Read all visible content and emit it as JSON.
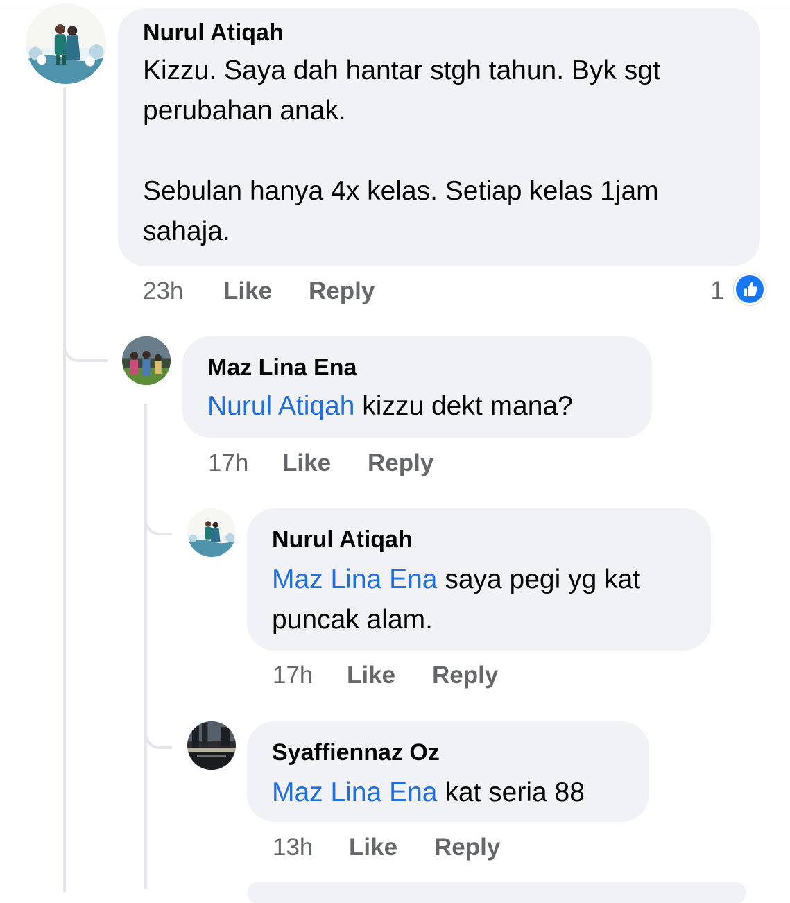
{
  "comments": [
    {
      "author": "Nurul Atiqah",
      "text": "Kizzu. Saya dah hantar stgh tahun. Byk sgt perubahan anak.\n\nSebulan hanya 4x kelas. Setiap kelas 1jam sahaja.",
      "time": "23h",
      "like_label": "Like",
      "reply_label": "Reply",
      "reaction_count": "1",
      "reaction_icon": "thumbs-up-icon",
      "avatar_icon": "wedding-couple-avatar"
    },
    {
      "author": "Maz Lina Ena",
      "mention": "Nurul Atiqah",
      "text": " kizzu dekt mana?",
      "time": "17h",
      "like_label": "Like",
      "reply_label": "Reply",
      "avatar_icon": "family-photo-avatar"
    },
    {
      "author": "Nurul Atiqah",
      "mention": "Maz Lina Ena",
      "text": " saya pegi yg kat\npuncak alam.",
      "time": "17h",
      "like_label": "Like",
      "reply_label": "Reply",
      "avatar_icon": "wedding-couple-avatar"
    },
    {
      "author": "Syaffiennaz Oz",
      "mention": "Maz Lina Ena",
      "text": " kat seria 88",
      "time": "13h",
      "like_label": "Like",
      "reply_label": "Reply",
      "avatar_icon": "city-photo-avatar"
    }
  ],
  "colors": {
    "bubble": "#f0f2f5",
    "mention": "#216fdb",
    "meta": "#65676b",
    "like_blue": "#1877f2",
    "thread_line": "#e4e6eb"
  }
}
